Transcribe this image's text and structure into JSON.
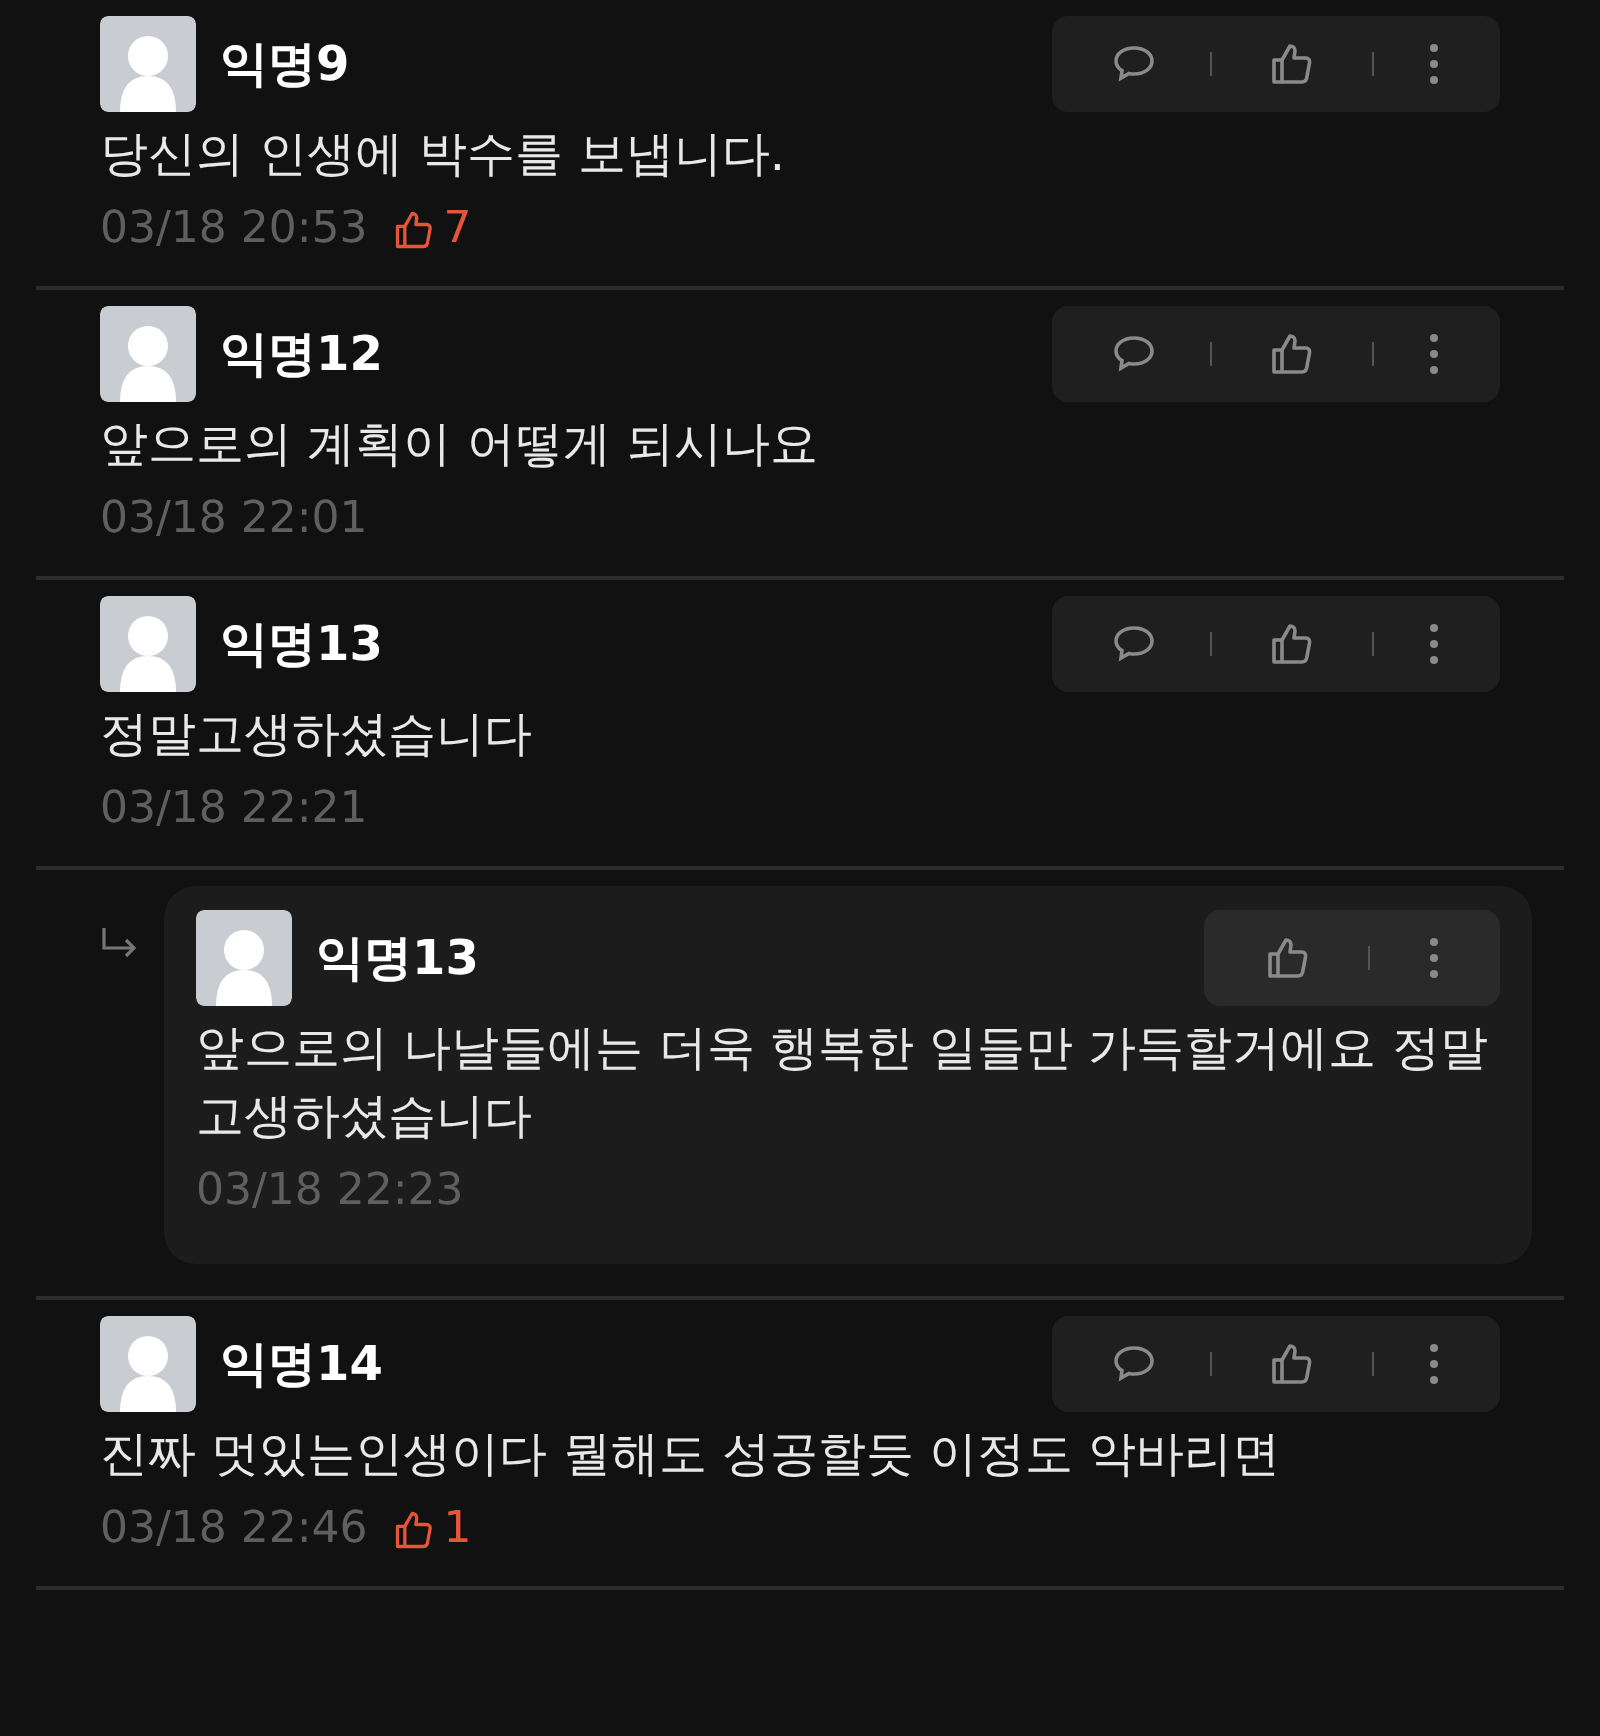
{
  "comments": [
    {
      "kind": "comment",
      "author": "익명9",
      "body": "당신의 인생에 박수를 보냅니다.",
      "time": "03/18 20:53",
      "likes": "7"
    },
    {
      "kind": "comment",
      "author": "익명12",
      "body": "앞으로의 계획이 어떻게 되시나요",
      "time": "03/18 22:01"
    },
    {
      "kind": "comment",
      "author": "익명13",
      "body": "정말고생하셨습니다",
      "time": "03/18 22:21"
    },
    {
      "kind": "reply",
      "author": "익명13",
      "body": "앞으로의 나날들에는 더욱 행복한 일들만 가득할거에요 정말 고생하셨습니다",
      "time": "03/18 22:23"
    },
    {
      "kind": "comment",
      "author": "익명14",
      "body": "진짜 멋있는인생이다 뭘해도 성공할듯 이정도 악바리면",
      "time": "03/18 22:46",
      "likes": "1"
    }
  ]
}
